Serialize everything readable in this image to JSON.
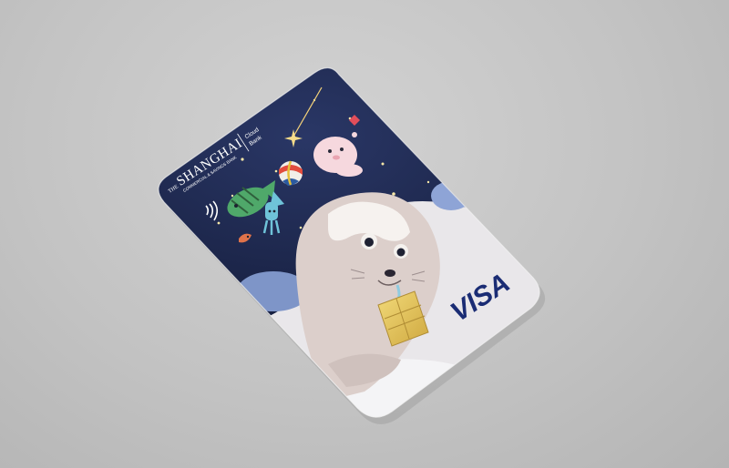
{
  "card": {
    "bank_prefix": "THE",
    "bank_name": "SHANGHAI",
    "bank_subtitle": "COMMERCIAL & SAVINGS BANK",
    "partner_line1": "Cloud",
    "partner_line2": "Bank",
    "network": "VISA",
    "contactless_icon": "contactless-icon",
    "colors": {
      "background": "#c4c4c4",
      "night_sky": "#1b2547",
      "seal_body": "#d9cdca",
      "visa_blue": "#1a2c74",
      "chip_gold": "#e3c55a"
    }
  }
}
